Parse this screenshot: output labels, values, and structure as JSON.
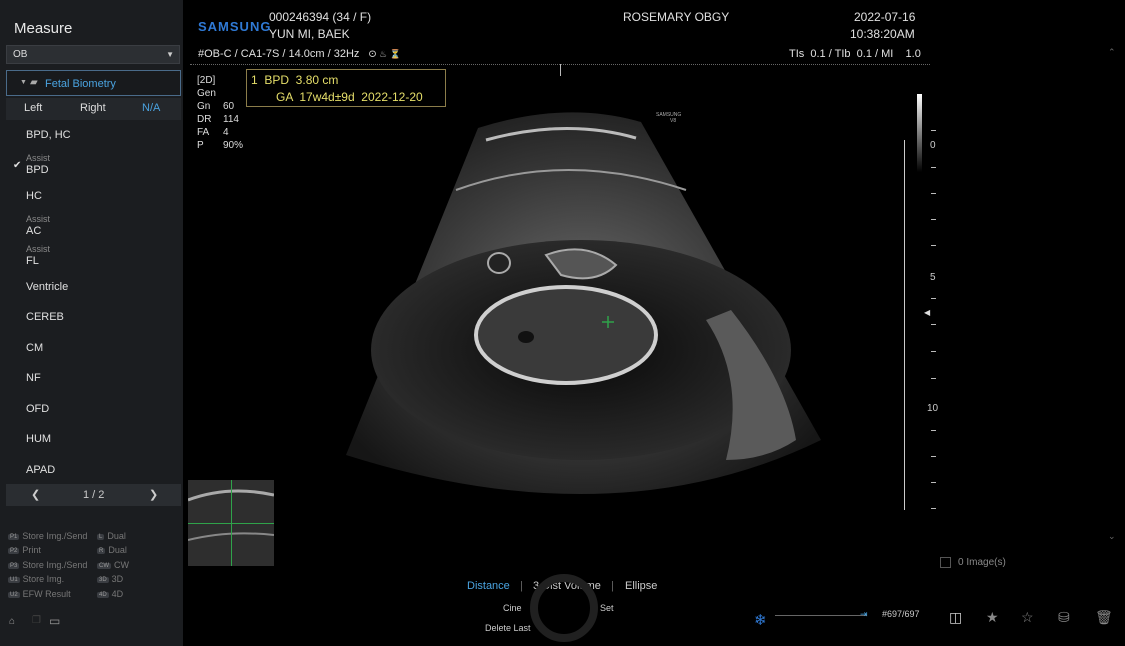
{
  "sidebar": {
    "title": "Measure",
    "select_value": "OB",
    "category": "Fetal Biometry",
    "sides": [
      "Left",
      "Right",
      "N/A"
    ],
    "items": [
      {
        "label": "BPD, HC",
        "assist": ""
      },
      {
        "label": "BPD",
        "assist": "Assist"
      },
      {
        "label": "HC",
        "assist": ""
      },
      {
        "label": "AC",
        "assist": "Assist"
      },
      {
        "label": "FL",
        "assist": "Assist"
      },
      {
        "label": "Ventricle",
        "assist": ""
      },
      {
        "label": "CEREB",
        "assist": ""
      },
      {
        "label": "CM",
        "assist": ""
      },
      {
        "label": "NF",
        "assist": ""
      },
      {
        "label": "OFD",
        "assist": ""
      },
      {
        "label": "HUM",
        "assist": ""
      },
      {
        "label": "APAD",
        "assist": ""
      }
    ],
    "pager": "1 / 2",
    "keys_left": [
      {
        "cap": "P1",
        "label": "Store Img./Send"
      },
      {
        "cap": "P2",
        "label": "Print"
      },
      {
        "cap": "P3",
        "label": "Store Img./Send"
      },
      {
        "cap": "U1",
        "label": "Store Img."
      },
      {
        "cap": "U2",
        "label": "EFW Result"
      }
    ],
    "keys_right": [
      {
        "cap": "L",
        "label": "Dual"
      },
      {
        "cap": "R",
        "label": "Dual"
      },
      {
        "cap": "CW",
        "label": "CW"
      },
      {
        "cap": "3D",
        "label": "3D"
      },
      {
        "cap": "4D",
        "label": "4D"
      }
    ]
  },
  "header": {
    "brand": "SAMSUNG",
    "patient_id": "000246394 (34 / F)",
    "patient_name": "YUN MI, BAEK",
    "institution": "ROSEMARY OBGY",
    "date": "2022-07-16",
    "time": "10:38:20AM",
    "preset": "#OB-C / CA1-7S / 14.0cm / 32Hz",
    "indices": "TIs  0.1 / TIb  0.1 / MI    1.0"
  },
  "image_params": {
    "mode": "[2D]",
    "rows": [
      {
        "key": "Gen",
        "value": ""
      },
      {
        "key": "Gn",
        "value": "60"
      },
      {
        "key": "DR",
        "value": "114"
      },
      {
        "key": "FA",
        "value": "4"
      },
      {
        "key": "P",
        "value": "90%"
      }
    ]
  },
  "result": {
    "line1": "1  BPD  3.80 cm",
    "line2": "GA  17w4d±9d  2022-12-20"
  },
  "watermark": [
    "SAMSUNG",
    "V8"
  ],
  "depth_labels": [
    "0",
    "5",
    "10"
  ],
  "bottom": {
    "image_count": "0 Image(s)",
    "tools": [
      "Distance",
      "3 Dist Volume",
      "Ellipse"
    ],
    "trackball": {
      "left": "Cine",
      "right": "Set",
      "bottom": "Delete Last"
    },
    "frame": "#697/697"
  },
  "colors": {
    "accent": "#4aa3e0",
    "brand": "#2f79d4",
    "result": "#e6df6a",
    "caliper": "#2fa34a"
  }
}
